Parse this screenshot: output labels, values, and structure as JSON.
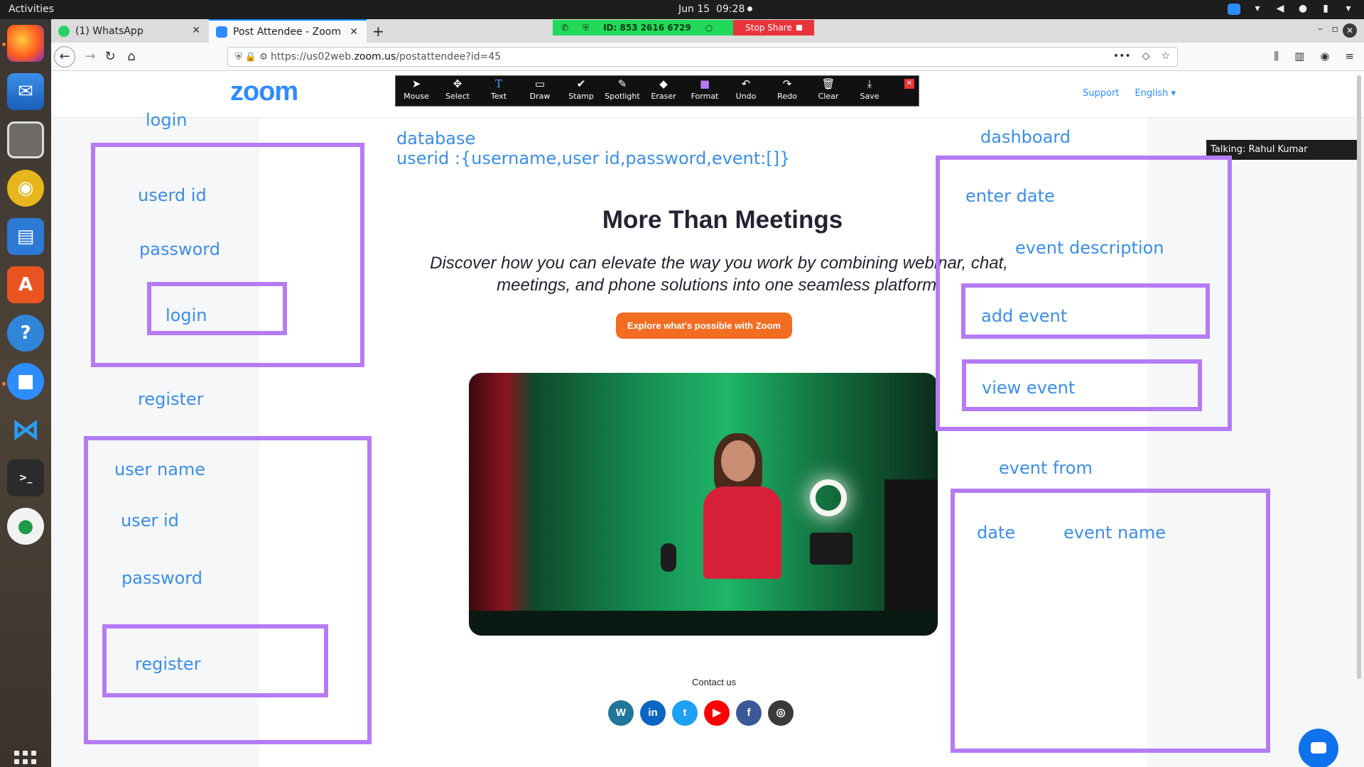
{
  "system": {
    "activities": "Activities",
    "date": "Jun 15",
    "time": "09:28"
  },
  "tabs": [
    {
      "title": "(1) WhatsApp",
      "icon": "whatsapp-icon"
    },
    {
      "title": "Post Attendee - Zoom",
      "icon": "zoom-icon"
    }
  ],
  "share_bar": {
    "meeting_id": "ID: 853 2616 6729",
    "stop_label": "Stop Share"
  },
  "address": {
    "prefix": "https://us02web.",
    "host": "zoom.us",
    "path": "/postattendee?id=45"
  },
  "page": {
    "logo": "zoom",
    "support": "Support",
    "language": "English",
    "title": "More Than Meetings",
    "subtitle_line1": "Discover how you can elevate the way you work by combining webinar, chat,",
    "subtitle_line2": "meetings, and phone solutions into one seamless platform.",
    "cta": "Explore what's possible with Zoom",
    "contact": "Contact us",
    "socials": [
      "wordpress-icon",
      "linkedin-icon",
      "twitter-icon",
      "youtube-icon",
      "facebook-icon",
      "instagram-icon"
    ]
  },
  "annotation_toolbar": {
    "tools": [
      "Mouse",
      "Select",
      "Text",
      "Draw",
      "Stamp",
      "Spotlight",
      "Eraser",
      "Format",
      "Undo",
      "Redo",
      "Clear",
      "Save"
    ]
  },
  "talking": "Talking: Rahul Kumar",
  "whiteboard": {
    "login_title": "login",
    "login_userid": "userd id",
    "login_password": "password",
    "login_button": "login",
    "register_title": "register",
    "register_username": "user name",
    "register_userid": "user id",
    "register_password": "password",
    "register_button": "register",
    "database_title": "database",
    "database_schema": "userid :{username,user id,password,event:[]}",
    "dashboard_title": "dashboard",
    "dashboard_date": "enter date",
    "dashboard_desc": "event description",
    "dashboard_add": "add event",
    "dashboard_view": "view event",
    "eventfrom_title": "event from",
    "eventfrom_date": "date",
    "eventfrom_name": "event name"
  },
  "colors": {
    "zoom_blue": "#2d8cff",
    "annotation_text": "#3b8ee8",
    "annotation_box": "#b57bf5",
    "cta_orange": "#f26d21"
  }
}
